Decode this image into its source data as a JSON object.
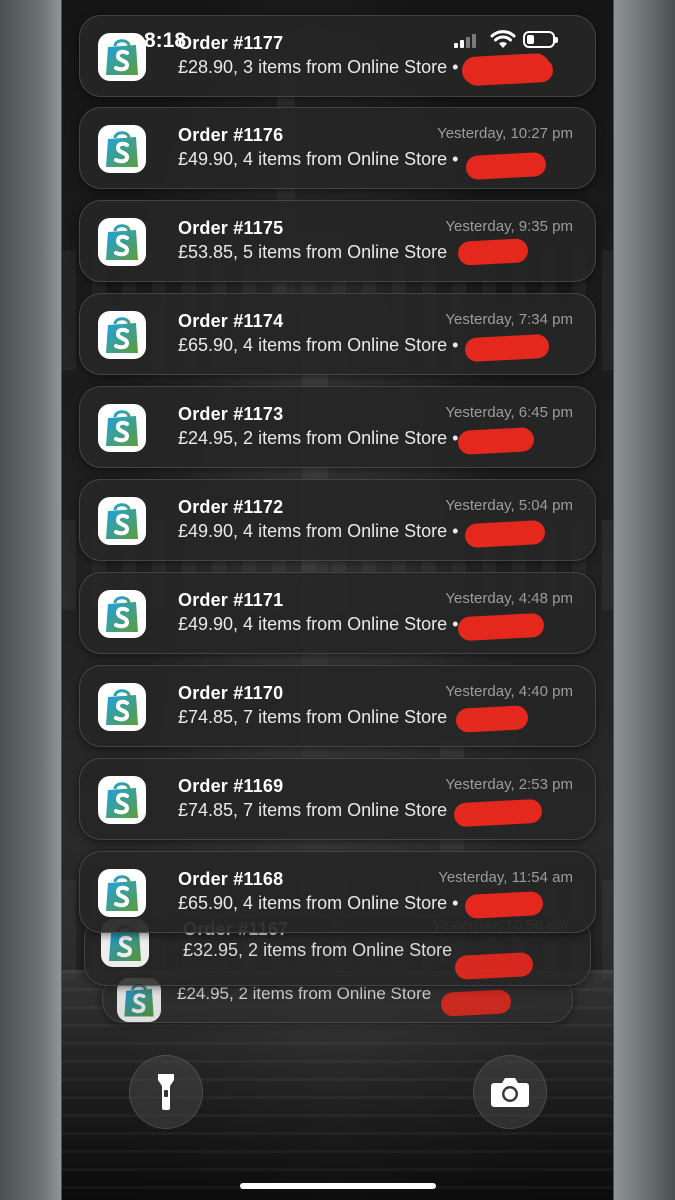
{
  "status_bar": {
    "time": "8:18"
  },
  "notifications": [
    {
      "title": "Order #1177",
      "time": "",
      "body": "£28.90, 3 items from Online Store •"
    },
    {
      "title": "Order #1176",
      "time": "Yesterday, 10:27 pm",
      "body": "£49.90, 4 items from Online Store •"
    },
    {
      "title": "Order #1175",
      "time": "Yesterday, 9:35 pm",
      "body": "£53.85, 5 items from Online Store"
    },
    {
      "title": "Order #1174",
      "time": "Yesterday, 7:34 pm",
      "body": "£65.90, 4 items from Online Store •"
    },
    {
      "title": "Order #1173",
      "time": "Yesterday, 6:45 pm",
      "body": "£24.95, 2 items from Online Store •"
    },
    {
      "title": "Order #1172",
      "time": "Yesterday, 5:04 pm",
      "body": "£49.90, 4 items from Online Store •"
    },
    {
      "title": "Order #1171",
      "time": "Yesterday, 4:48 pm",
      "body": "£49.90, 4 items from Online Store •"
    },
    {
      "title": "Order #1170",
      "time": "Yesterday, 4:40 pm",
      "body": "£74.85, 7 items from Online Store"
    },
    {
      "title": "Order #1169",
      "time": "Yesterday, 2:53 pm",
      "body": "£74.85, 7 items from Online Store"
    },
    {
      "title": "Order #1168",
      "time": "Yesterday, 11:54 am",
      "body": "£65.90, 4 items from Online Store •"
    },
    {
      "title": "Order #1167",
      "time": "Yesterday, 10:56 am",
      "body": "£32.95, 2 items from Online Store"
    },
    {
      "title": "",
      "time": "",
      "body": "£24.95, 2 items from Online Store"
    }
  ],
  "icons": {
    "app": "shopify-bag-icon",
    "flashlight": "flashlight-icon",
    "camera": "camera-icon"
  },
  "colors": {
    "redaction": "#e5281d",
    "shopify_blue": "#1da1e2",
    "shopify_green": "#5e9d3a"
  }
}
